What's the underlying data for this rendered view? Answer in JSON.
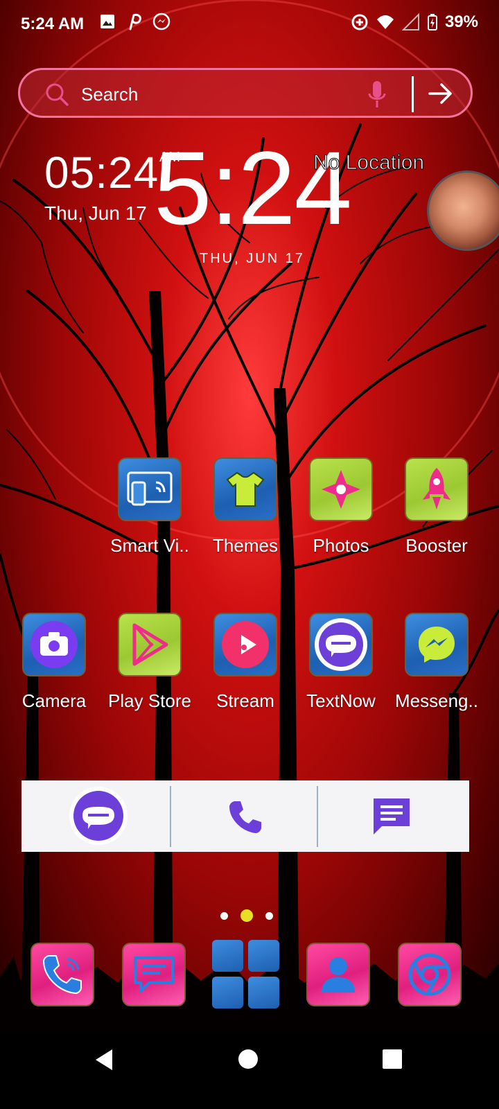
{
  "status_bar": {
    "time": "5:24 AM",
    "battery": "39%",
    "left_icons": [
      "gallery-icon",
      "pinterest-icon",
      "messenger-icon"
    ],
    "right_icons": [
      "data-saver-icon",
      "wifi-icon",
      "signal-icon",
      "battery-icon"
    ]
  },
  "search": {
    "label": "Search",
    "icons": [
      "search-icon",
      "mic-icon",
      "arrow-right-icon"
    ]
  },
  "clock_widget_small": {
    "time": "05:24",
    "ampm": "AM",
    "date": "Thu, Jun 17"
  },
  "clock_widget_big": {
    "time": "5:24",
    "date": "THU, JUN 17"
  },
  "weather": {
    "location": "No Location"
  },
  "apps_row1": [
    {
      "label": "Smart Vi..",
      "icon": "smart-view-icon"
    },
    {
      "label": "Themes",
      "icon": "themes-icon"
    },
    {
      "label": "Photos",
      "icon": "photos-icon"
    },
    {
      "label": "Booster",
      "icon": "booster-icon"
    }
  ],
  "apps_row2": [
    {
      "label": "Camera",
      "icon": "camera-icon"
    },
    {
      "label": "Play Store",
      "icon": "play-store-icon"
    },
    {
      "label": "Stream",
      "icon": "stream-icon"
    },
    {
      "label": "TextNow",
      "icon": "textnow-icon"
    },
    {
      "label": "Messeng..",
      "icon": "messenger-app-icon"
    }
  ],
  "widget_bar": {
    "icons": [
      "textnow-icon",
      "phone-icon",
      "message-icon"
    ]
  },
  "page_indicator": {
    "count": 3,
    "active": 2
  },
  "dock": {
    "icons": [
      "phone-icon",
      "messages-icon",
      "app-drawer-icon",
      "contacts-icon",
      "chrome-icon"
    ]
  },
  "nav_bar": {
    "icons": [
      "back-icon",
      "home-icon",
      "recents-icon"
    ]
  },
  "colors": {
    "accent_pink": "#f2739c",
    "purple": "#6b3fd8",
    "dot_active": "#e8e020"
  }
}
